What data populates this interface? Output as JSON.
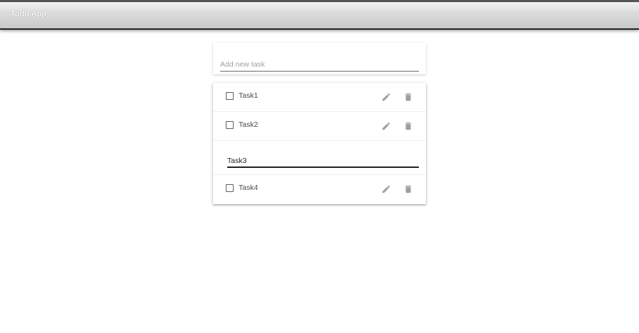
{
  "app": {
    "title": "Todo App"
  },
  "new_task": {
    "placeholder": "Add new task",
    "value": ""
  },
  "tasks": [
    {
      "label": "Task1",
      "checked": false,
      "edit_icon": "pencil-icon",
      "delete_icon": "trash-icon"
    },
    {
      "label": "Task2",
      "checked": false,
      "edit_icon": "pencil-icon",
      "delete_icon": "trash-icon"
    },
    {
      "label": "Task3",
      "checked": false,
      "editing": true
    },
    {
      "label": "Task4",
      "checked": false,
      "edit_icon": "pencil-icon",
      "delete_icon": "trash-icon"
    }
  ],
  "colors": {
    "icon": "#9e9e9e",
    "edit_underline": "#222222"
  }
}
